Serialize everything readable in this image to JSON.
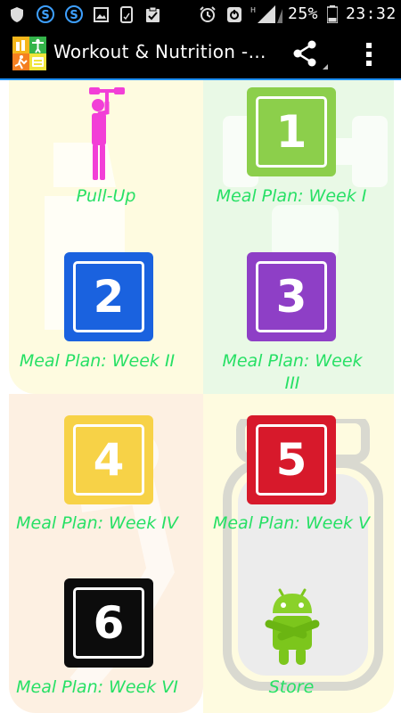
{
  "status_bar": {
    "battery_percent": "25%",
    "time": "23:32",
    "icons": [
      "shield-icon",
      "s-app-icon",
      "s-app-icon",
      "image-icon",
      "phone-icon",
      "clipboard-check-icon",
      "alarm-icon",
      "nfc-icon",
      "signal-icon",
      "battery-icon"
    ]
  },
  "action_bar": {
    "title": "Workout & Nutrition -…",
    "share_icon": "share-icon",
    "overflow_icon": "overflow-menu-icon"
  },
  "tiles": [
    {
      "label": "Pull-Up",
      "icon": "pullup-figure-icon"
    },
    {
      "label": "Meal Plan: Week I",
      "number": "1",
      "color": "#8ccf4b"
    },
    {
      "label": "Meal Plan: Week II",
      "number": "2",
      "color": "#1a62df"
    },
    {
      "label": "Meal Plan: Week III",
      "number": "3",
      "color": "#8e3fc6"
    },
    {
      "label": "Meal Plan: Week IV",
      "number": "4",
      "color": "#f7d247"
    },
    {
      "label": "Meal Plan: Week V",
      "number": "5",
      "color": "#d7192b"
    },
    {
      "label": "Meal Plan: Week VI",
      "number": "6",
      "color": "#0c0c0c"
    },
    {
      "label": "Store",
      "icon": "android-robot-icon"
    }
  ],
  "colors": {
    "label_green": "#27e065",
    "accent_blue": "#1e90ff",
    "bg_yellow": "#fefbe0",
    "bg_green": "#e9f9e6",
    "bg_orange": "#fdf0e2"
  }
}
